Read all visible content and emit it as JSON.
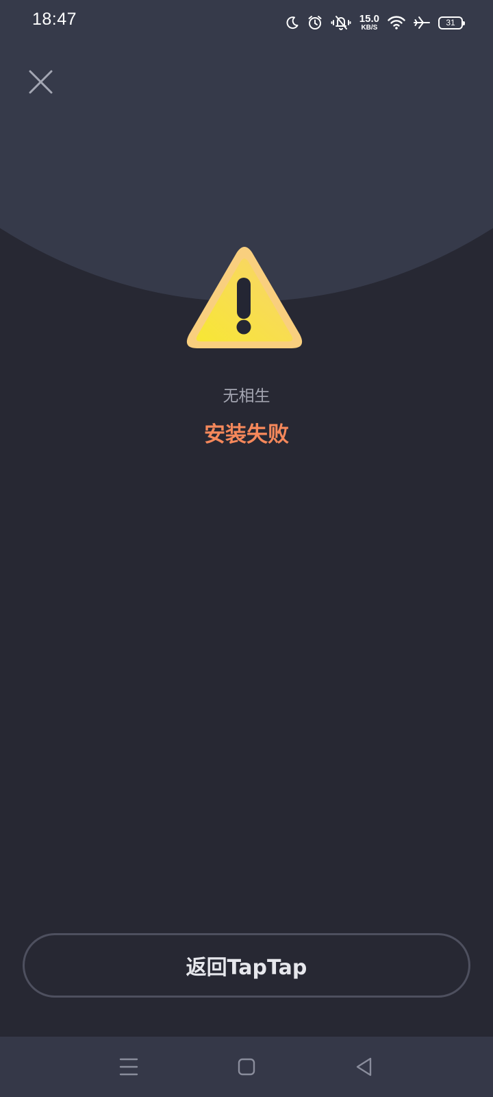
{
  "status_bar": {
    "time": "18:47",
    "net_speed_value": "15.0",
    "net_speed_unit": "KB/S",
    "battery_level": "31",
    "icons": [
      "moon-icon",
      "alarm-icon",
      "vibrate-icon",
      "wifi-icon",
      "airplane-icon",
      "battery-icon"
    ]
  },
  "header": {
    "close_icon": "close-icon"
  },
  "main": {
    "icon": "warning-icon",
    "app_name": "无相生",
    "status_text": "安装失败"
  },
  "footer": {
    "back_button_label": "返回TapTap"
  },
  "nav_bar": {
    "icons": [
      "menu-icon",
      "home-icon",
      "back-icon"
    ]
  },
  "colors": {
    "background": "#272833",
    "arc": "#363a4a",
    "error_accent": "#f5885b",
    "warning_yellow": "#f7e23a"
  }
}
